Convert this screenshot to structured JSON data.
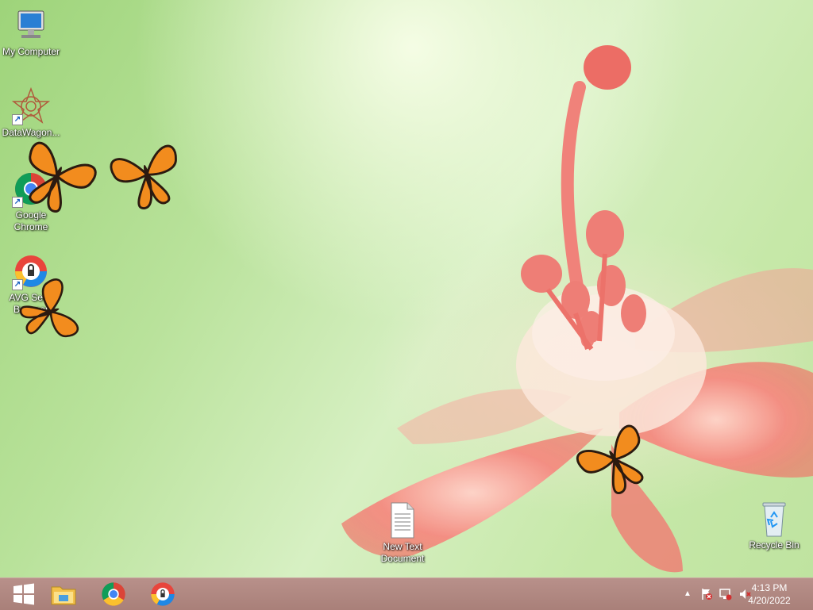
{
  "desktop": {
    "icons": [
      {
        "label": "My Computer"
      },
      {
        "label": "DataWagon..."
      },
      {
        "label": "Google Chrome"
      },
      {
        "label": "AVG Secu Browser"
      },
      {
        "label": "New Text Document"
      },
      {
        "label": "Recycle Bin"
      }
    ]
  },
  "taskbar": {
    "start": "windows-logo-icon",
    "pinned": [
      "file-explorer-icon",
      "chrome-icon",
      "avg-secure-browser-icon"
    ],
    "tray": {
      "icons": [
        "show-hidden-icons-arrow",
        "action-center-flag-icon",
        "network-icon",
        "volume-muted-icon"
      ],
      "time": "4:13 PM",
      "date": "4/20/2022"
    }
  },
  "colors": {
    "taskbar": "#b08882",
    "wallpaper_green": "#c6e8a8",
    "flower_pink": "#f07a72"
  }
}
